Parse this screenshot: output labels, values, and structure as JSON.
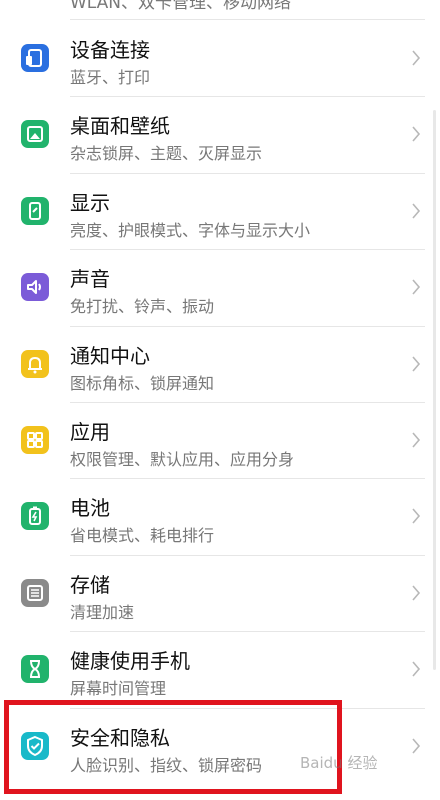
{
  "partial_top_text": "WLAN、双卡管理、移动网络",
  "items": [
    {
      "title": "设备连接",
      "subtitle": "蓝牙、打印",
      "icon": "device-connection-icon",
      "color": "#2a6fe0"
    },
    {
      "title": "桌面和壁纸",
      "subtitle": "杂志锁屏、主题、灭屏显示",
      "icon": "wallpaper-icon",
      "color": "#21b36c"
    },
    {
      "title": "显示",
      "subtitle": "亮度、护眼模式、字体与显示大小",
      "icon": "display-icon",
      "color": "#21b36c"
    },
    {
      "title": "声音",
      "subtitle": "免打扰、铃声、振动",
      "icon": "sound-icon",
      "color": "#7b5bd8"
    },
    {
      "title": "通知中心",
      "subtitle": "图标角标、锁屏通知",
      "icon": "notification-bell-icon",
      "color": "#f2c21c"
    },
    {
      "title": "应用",
      "subtitle": "权限管理、默认应用、应用分身",
      "icon": "apps-grid-icon",
      "color": "#f2c21c"
    },
    {
      "title": "电池",
      "subtitle": "省电模式、耗电排行",
      "icon": "battery-icon",
      "color": "#21b36c"
    },
    {
      "title": "存储",
      "subtitle": "清理加速",
      "icon": "storage-icon",
      "color": "#8a8a8a"
    },
    {
      "title": "健康使用手机",
      "subtitle": "屏幕时间管理",
      "icon": "hourglass-icon",
      "color": "#21b36c"
    },
    {
      "title": "安全和隐私",
      "subtitle": "人脸识别、指纹、锁屏密码",
      "icon": "shield-icon",
      "color": "#19b9c9"
    }
  ],
  "watermark": "Baidu 经验"
}
